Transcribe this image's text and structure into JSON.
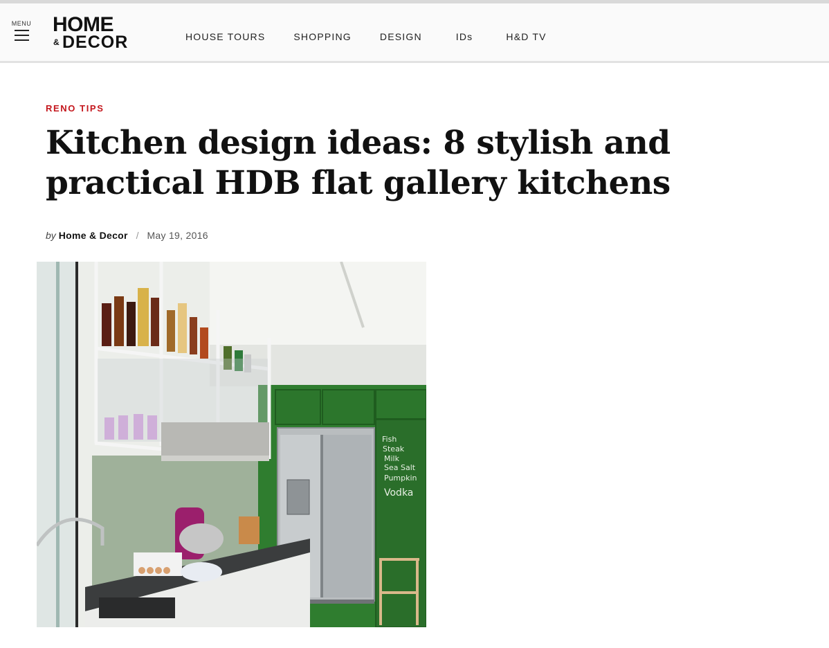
{
  "header": {
    "menu_label": "MENU",
    "logo": {
      "line1": "HOME",
      "amp": "&",
      "line2": "DECOR"
    },
    "nav": [
      "HOUSE TOURS",
      "SHOPPING",
      "DESIGN",
      "IDs",
      "H&D TV"
    ]
  },
  "article": {
    "category": "RENO TIPS",
    "title": "Kitchen design ideas: 8 stylish and practical HDB flat gallery kitchens",
    "byline": {
      "by": "by",
      "author": "Home & Decor",
      "separator": "/",
      "date": "May 19, 2016"
    },
    "image": {
      "chalkboard": [
        "Fish",
        "Steak",
        "Milk",
        "Sea Salt",
        "Pumpkin",
        "Vodka"
      ]
    }
  },
  "colors": {
    "accent": "#c4161c",
    "cabinet_green": "#2f7d2f"
  },
  "icons": [
    "menu-icon"
  ]
}
